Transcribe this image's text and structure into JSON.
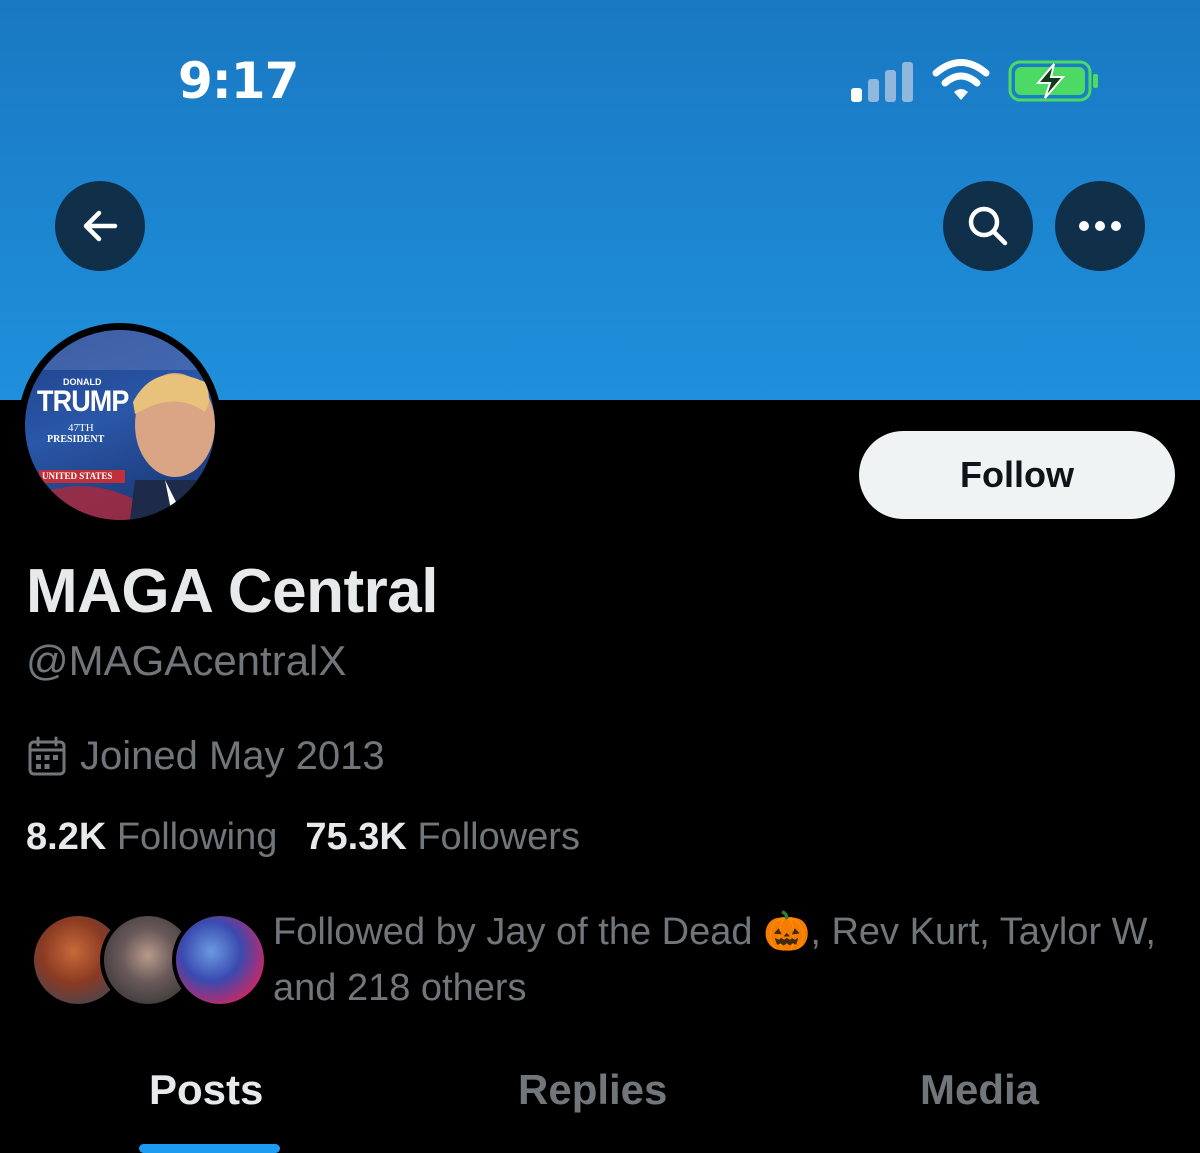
{
  "status_bar": {
    "time": "9:17",
    "signal_icon": "cellular-signal-icon",
    "wifi_icon": "wifi-icon",
    "battery_icon": "battery-charging-icon",
    "battery_color": "#4cd964"
  },
  "header": {
    "back_icon": "arrow-left-icon",
    "search_icon": "search-icon",
    "more_icon": "more-horizontal-icon",
    "banner_color": "#1d8ad6"
  },
  "avatar": {
    "line_1": "DONALD",
    "line_2": "TRUMP",
    "line_3": "47TH",
    "line_4": "PRESIDENT",
    "line_5": "UNITED STATES"
  },
  "profile": {
    "follow_label": "Follow",
    "display_name": "MAGA Central",
    "handle": "@MAGAcentralX",
    "joined_icon": "calendar-icon",
    "joined": "Joined May 2013",
    "following_count": "8.2K",
    "following_label": "Following",
    "followers_count": "75.3K",
    "followers_label": "Followers",
    "followed_by": "Followed by Jay of the Dead 🎃, Rev Kurt, Taylor W, and 218 others"
  },
  "tabs": [
    {
      "label": "Posts",
      "active": true
    },
    {
      "label": "Replies",
      "active": false
    },
    {
      "label": "Media",
      "active": false
    }
  ],
  "colors": {
    "accent": "#1d9bf0",
    "muted_text": "#71767b",
    "primary_text": "#e7e9ea"
  }
}
